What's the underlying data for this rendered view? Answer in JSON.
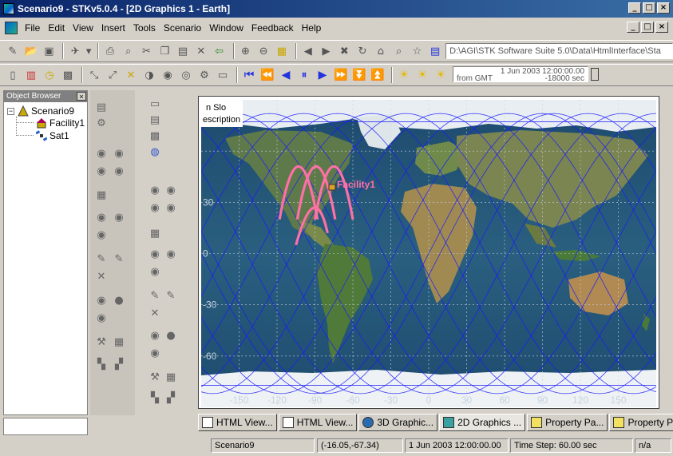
{
  "window": {
    "title": "Scenario9 - STKv5.0.4 - [2D Graphics 1 - Earth]",
    "min": "_",
    "max": "□",
    "close": "×"
  },
  "menu": {
    "items": [
      "File",
      "Edit",
      "View",
      "Insert",
      "Tools",
      "Scenario",
      "Window",
      "Feedback",
      "Help"
    ]
  },
  "toolbar": {
    "address": "D:\\AGI\\STK Software Suite 5.0\\Data\\HtmlInterface\\Sta",
    "time_display": "1 Jun 2003 12:00:00.00",
    "from_label": "from GMT",
    "offset": "-18000 sec"
  },
  "object_browser": {
    "title": "Object Browser",
    "scenario": "Scenario9",
    "facility": "Facility1",
    "satellite": "Sat1"
  },
  "map": {
    "lat_labels": [
      "30",
      "0",
      "-30",
      "-60"
    ],
    "lon_labels": [
      "-150",
      "-120",
      "-90",
      "-60",
      "-30",
      "0",
      "30",
      "60",
      "90",
      "120",
      "150"
    ],
    "facility_label": "Facility1",
    "overlay_text_1": "n Slo",
    "overlay_text_2": "escription",
    "ground_track_color": "#1a1aff",
    "swath_color": "#ff6fa8"
  },
  "tabs": [
    {
      "label": "HTML View..."
    },
    {
      "label": "HTML View..."
    },
    {
      "label": "3D Graphic..."
    },
    {
      "label": "2D Graphics ..."
    },
    {
      "label": "Property Pa..."
    },
    {
      "label": "Property Pa..."
    }
  ],
  "status": {
    "scenario": "Scenario9",
    "coords": "(-16.05,-67.34)",
    "time": "1 Jun 2003 12:00:00.00",
    "step": "Time Step: 60.00 sec",
    "na": "n/a"
  }
}
